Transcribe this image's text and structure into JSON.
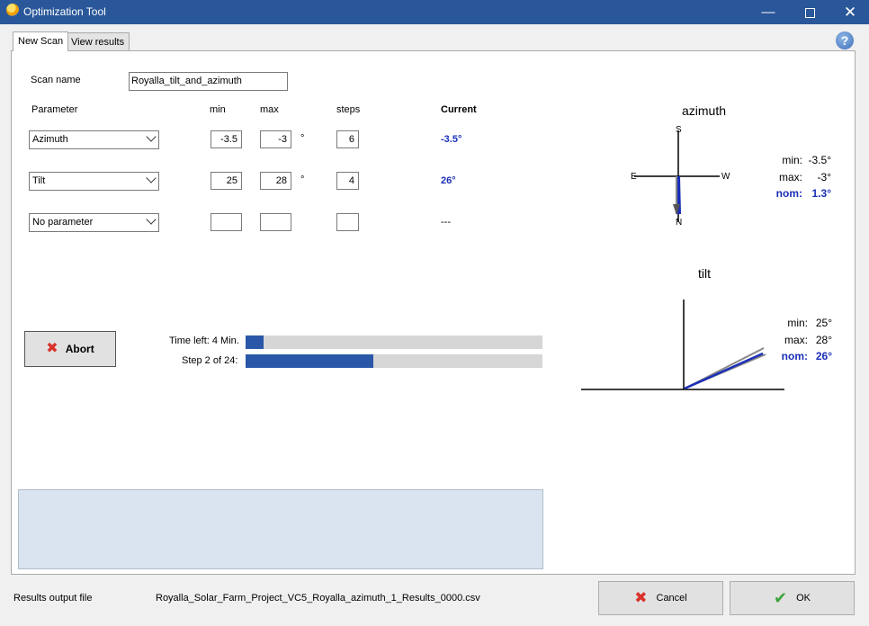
{
  "window": {
    "title": "Optimization Tool"
  },
  "tabs": [
    {
      "label": "New Scan"
    },
    {
      "label": "View results"
    }
  ],
  "help": {
    "icon": "question-icon",
    "glyph": "?"
  },
  "scan": {
    "name_label": "Scan name",
    "name_value": "Royalla_tilt_and_azimuth"
  },
  "table": {
    "headers": {
      "parameter": "Parameter",
      "min": "min",
      "max": "max",
      "steps": "steps",
      "current": "Current"
    },
    "unit": "°",
    "rows": [
      {
        "parameter": "Azimuth",
        "min": "-3.5",
        "max": "-3",
        "unit": "°",
        "steps": "6",
        "current": "-3.5°"
      },
      {
        "parameter": "Tilt",
        "min": "25",
        "max": "28",
        "unit": "°",
        "steps": "4",
        "current": "26°"
      },
      {
        "parameter": "No parameter",
        "min": "",
        "max": "",
        "unit": "",
        "steps": "",
        "current": "---"
      }
    ]
  },
  "abort": {
    "label": "Abort"
  },
  "progress": {
    "time_label": "Time left: 4 Min.",
    "time_fraction": 0.06,
    "step_label": "Step 2 of 24:",
    "step_fraction": 0.43
  },
  "azimuth_diagram": {
    "title": "azimuth",
    "compass": {
      "s": "S",
      "e": "E",
      "w": "W",
      "n": "N"
    },
    "min_label": "min:",
    "min_value": "-3.5°",
    "max_label": "max:",
    "max_value": "-3°",
    "nom_label": "nom:",
    "nom_value": "1.3°"
  },
  "tilt_diagram": {
    "title": "tilt",
    "min_label": "min:",
    "min_value": "25°",
    "max_label": "max:",
    "max_value": "28°",
    "nom_label": "nom:",
    "nom_value": "26°"
  },
  "footer": {
    "results_label": "Results output file",
    "results_file": "Royalla_Solar_Farm_Project_VC5_Royalla_azimuth_1_Results_0000.csv",
    "cancel_label": "Cancel",
    "ok_label": "OK"
  },
  "colors": {
    "titlebar": "#2a579a",
    "accent_blue": "#1a2fb8",
    "progress_fill": "#2a57a8",
    "abort_red": "#d9322b",
    "ok_green": "#3ea33e"
  }
}
